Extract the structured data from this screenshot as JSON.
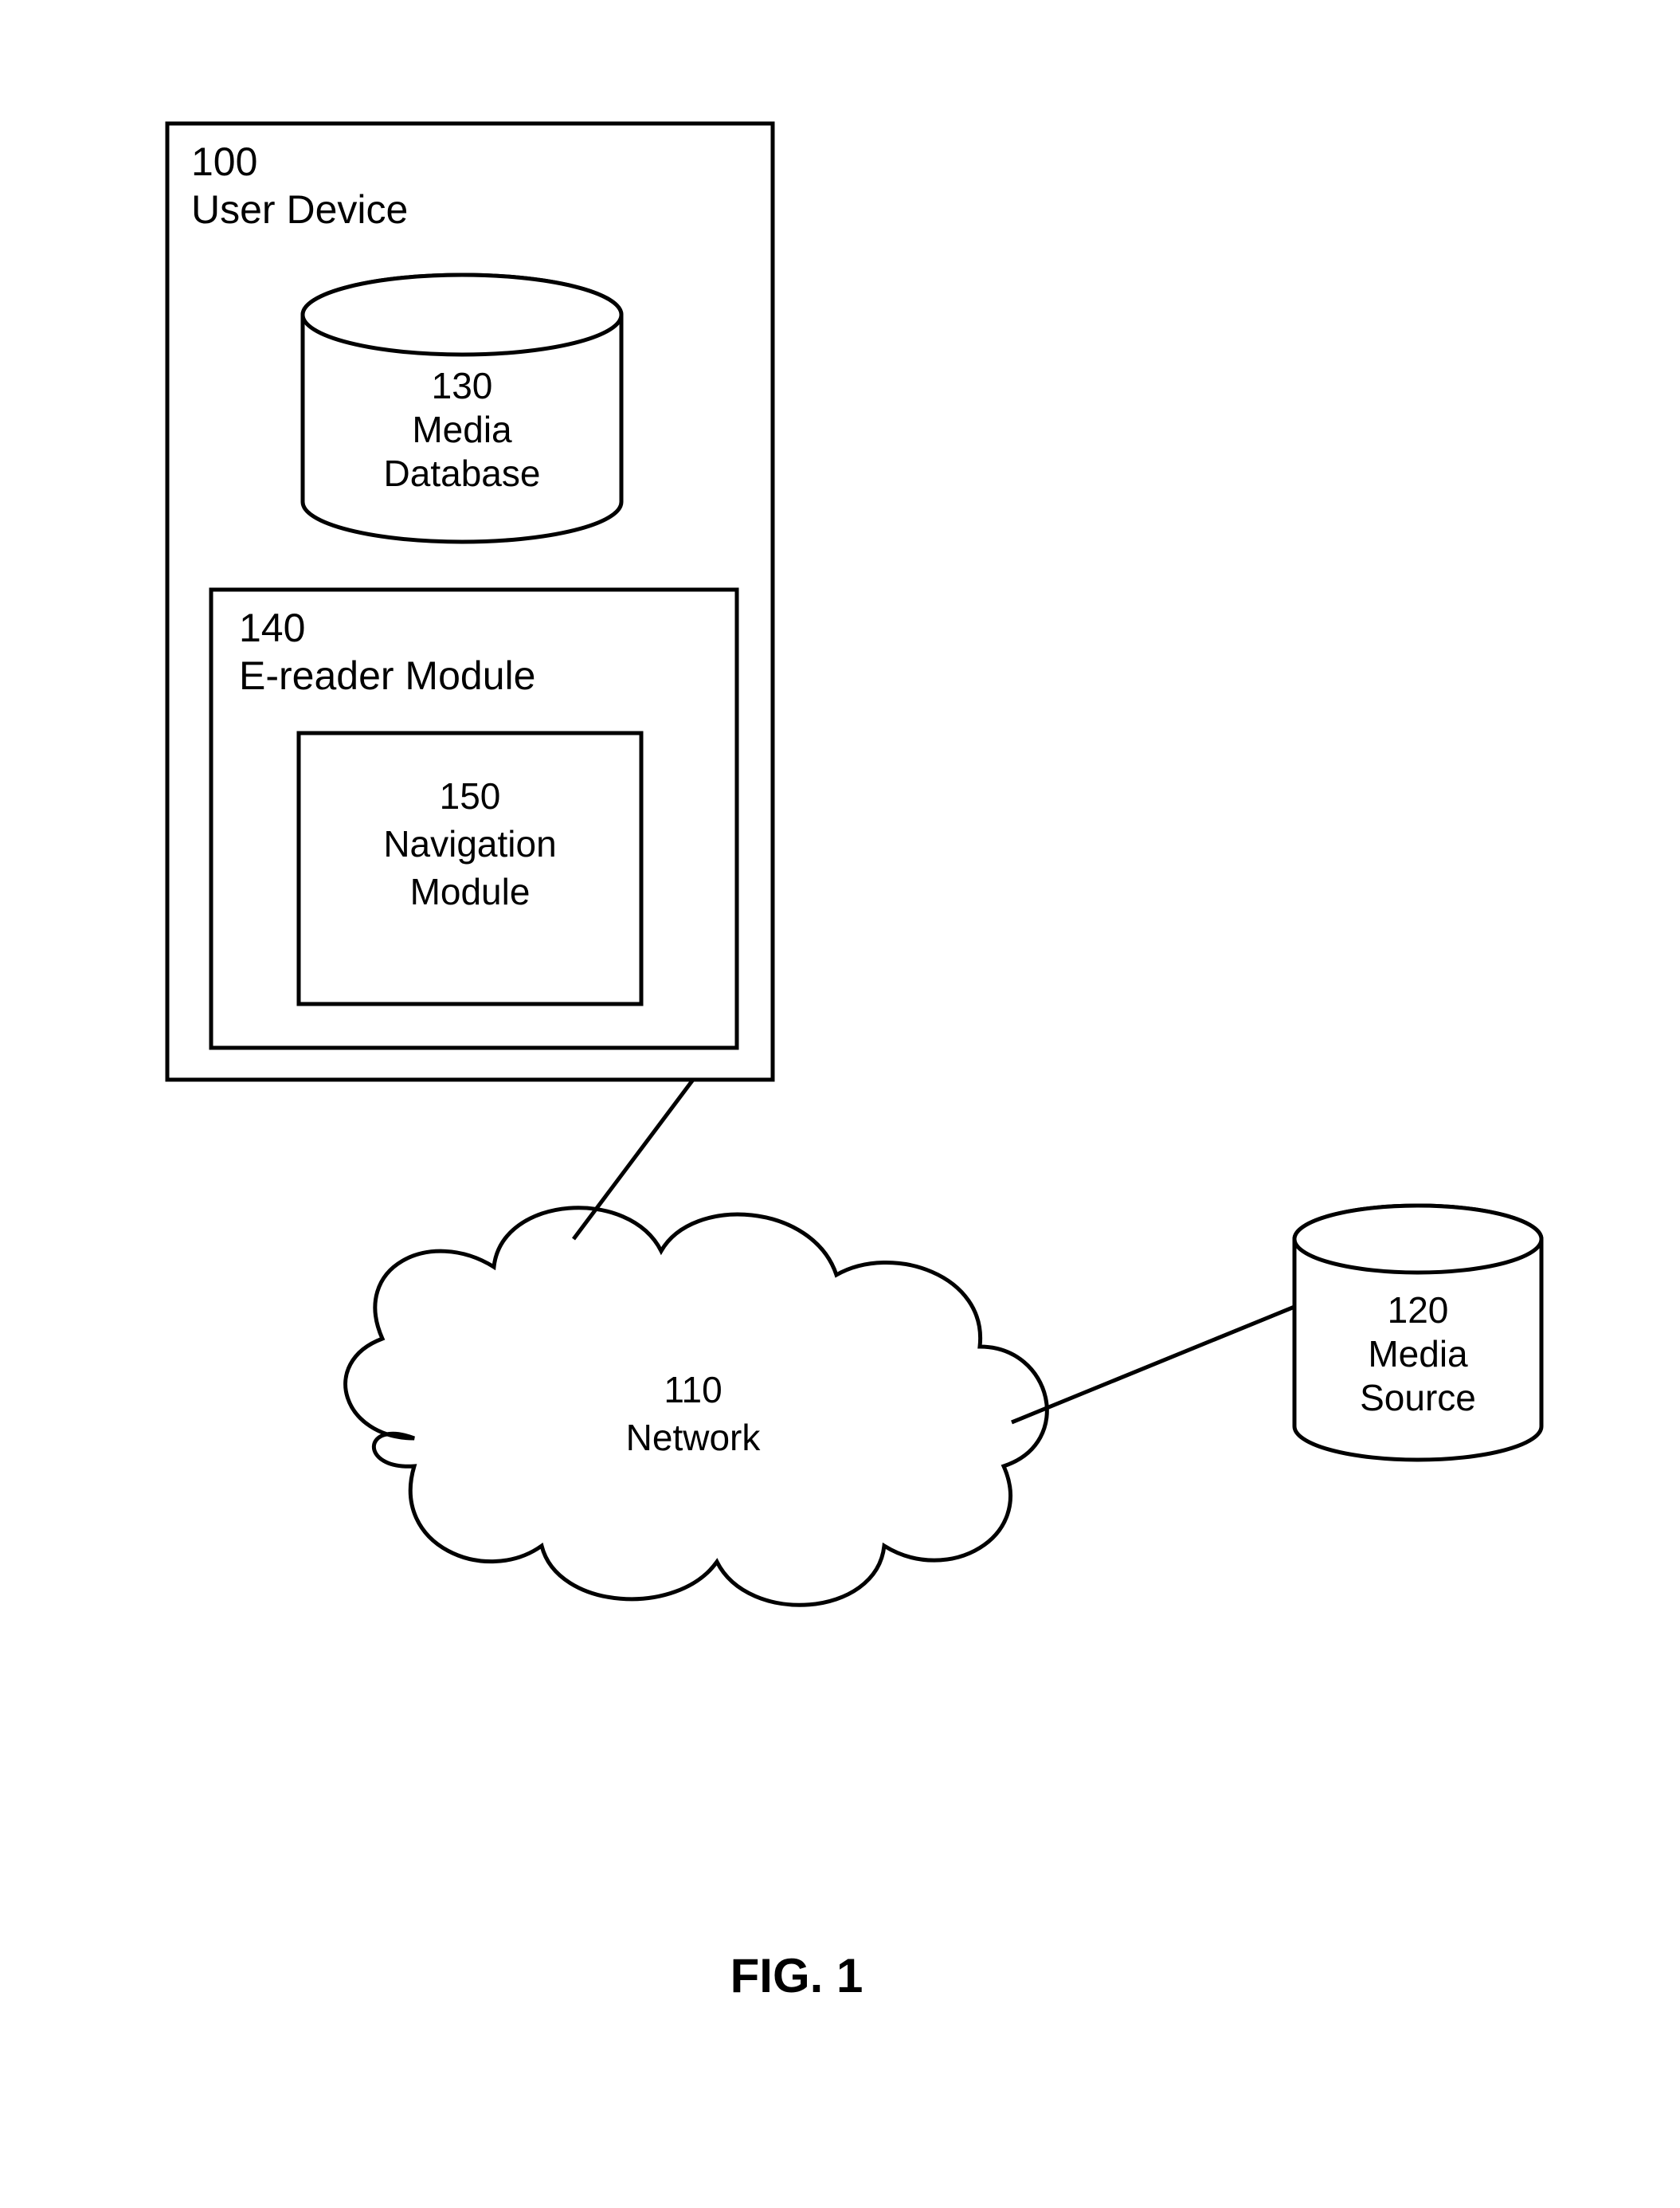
{
  "user_device": {
    "num": "100",
    "label": "User Device"
  },
  "media_database": {
    "num": "130",
    "label1": "Media",
    "label2": "Database"
  },
  "ereader": {
    "num": "140",
    "label": "E-reader Module"
  },
  "navigation": {
    "num": "150",
    "label1": "Navigation",
    "label2": "Module"
  },
  "network": {
    "num": "110",
    "label": "Network"
  },
  "media_source": {
    "num": "120",
    "label1": "Media",
    "label2": "Source"
  },
  "figure": {
    "caption": "FIG. 1"
  }
}
